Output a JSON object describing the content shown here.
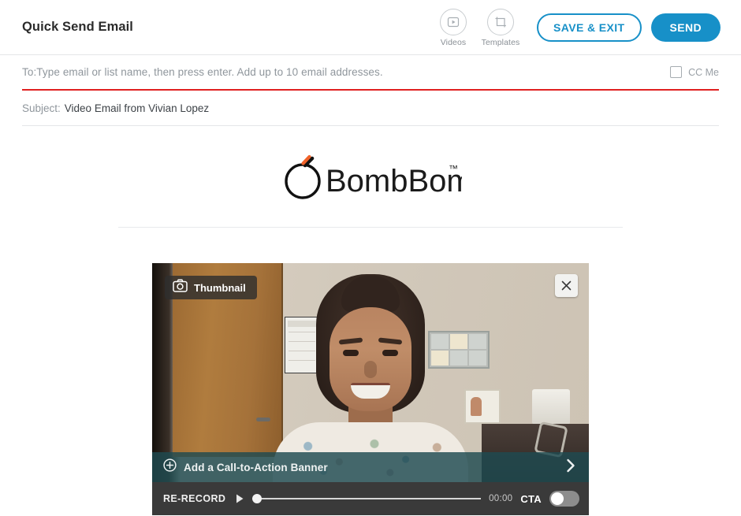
{
  "header": {
    "title": "Quick Send Email",
    "videos_label": "Videos",
    "templates_label": "Templates",
    "save_label": "SAVE & EXIT",
    "send_label": "SEND",
    "accent_color": "#1790c8"
  },
  "compose": {
    "to_placeholder": "To:Type email or list name, then press enter. Add up to 10 email addresses.",
    "to_error_color": "#e02020",
    "cc_label": "CC Me",
    "cc_checked": false,
    "subject_label": "Subject:",
    "subject_value": "Video Email from Vivian Lopez"
  },
  "branding": {
    "logo_text": "BombBomb",
    "logo_tm": "™",
    "logo_accent": "#f0622a"
  },
  "player": {
    "thumbnail_label": "Thumbnail",
    "close_label": "×",
    "cta_banner_label": "Add a Call-to-Action Banner",
    "rerecord_label": "RE-RECORD",
    "time_label": "00:00",
    "cta_toggle_label": "CTA",
    "cta_toggle_on": false,
    "progress_percent": 0
  }
}
